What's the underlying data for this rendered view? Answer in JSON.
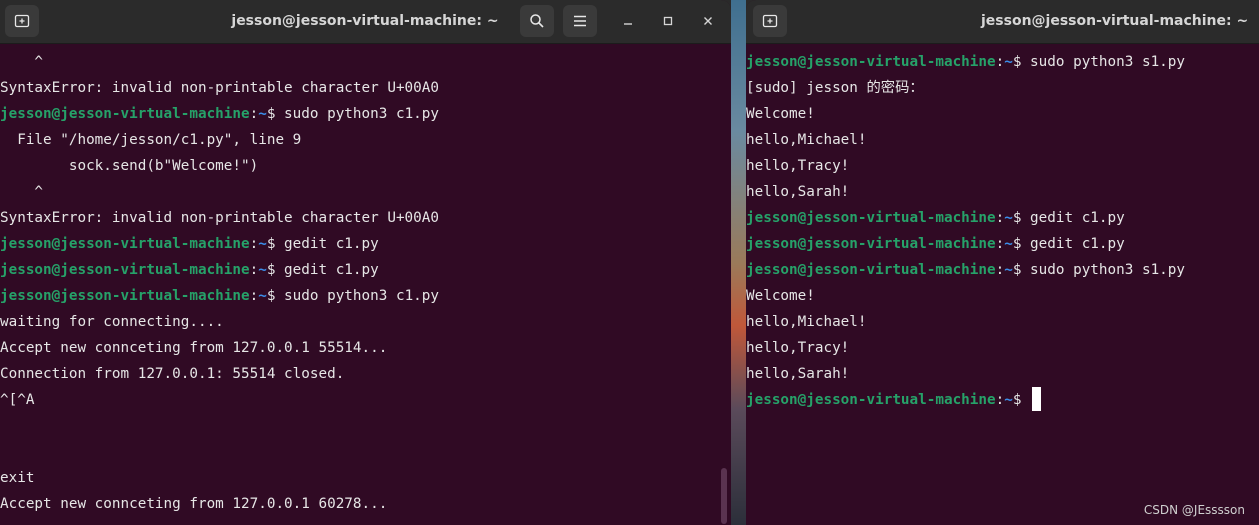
{
  "left_terminal": {
    "title": "jesson@jesson-virtual-machine: ~",
    "lines": [
      {
        "text": "    ^"
      },
      {
        "text": "SyntaxError: invalid non-printable character U+00A0"
      },
      {
        "prompt": true,
        "user": "jesson@jesson-virtual-machine",
        "path": "~",
        "cmd": "$ sudo python3 c1.py"
      },
      {
        "text": "  File \"/home/jesson/c1.py\", line 9"
      },
      {
        "text": "        sock.send(b\"Welcome!\")"
      },
      {
        "text": "    ^"
      },
      {
        "text": "SyntaxError: invalid non-printable character U+00A0"
      },
      {
        "prompt": true,
        "user": "jesson@jesson-virtual-machine",
        "path": "~",
        "cmd": "$ gedit c1.py"
      },
      {
        "prompt": true,
        "user": "jesson@jesson-virtual-machine",
        "path": "~",
        "cmd": "$ gedit c1.py"
      },
      {
        "prompt": true,
        "user": "jesson@jesson-virtual-machine",
        "path": "~",
        "cmd": "$ sudo python3 c1.py"
      },
      {
        "text": "waiting for connecting...."
      },
      {
        "text": "Accept new connceting from 127.0.0.1 55514..."
      },
      {
        "text": "Connection from 127.0.0.1: 55514 closed."
      },
      {
        "text": "^[^A"
      },
      {
        "text": ""
      },
      {
        "text": ""
      },
      {
        "text": "exit"
      },
      {
        "text": "Accept new connceting from 127.0.0.1 60278..."
      }
    ]
  },
  "right_terminal": {
    "title": "jesson@jesson-virtual-machine: ~",
    "lines": [
      {
        "prompt": true,
        "user": "jesson@jesson-virtual-machine",
        "path": "~",
        "cmd": "$ sudo python3 s1.py"
      },
      {
        "text": "[sudo] jesson 的密码："
      },
      {
        "text": "Welcome!"
      },
      {
        "text": "hello,Michael!"
      },
      {
        "text": "hello,Tracy!"
      },
      {
        "text": "hello,Sarah!"
      },
      {
        "prompt": true,
        "user": "jesson@jesson-virtual-machine",
        "path": "~",
        "cmd": "$ gedit c1.py"
      },
      {
        "prompt": true,
        "user": "jesson@jesson-virtual-machine",
        "path": "~",
        "cmd": "$ gedit c1.py"
      },
      {
        "prompt": true,
        "user": "jesson@jesson-virtual-machine",
        "path": "~",
        "cmd": "$ sudo python3 s1.py"
      },
      {
        "text": "Welcome!"
      },
      {
        "text": "hello,Michael!"
      },
      {
        "text": "hello,Tracy!"
      },
      {
        "text": "hello,Sarah!"
      },
      {
        "prompt": true,
        "user": "jesson@jesson-virtual-machine",
        "path": "~",
        "cmd": "$ ",
        "cursor": true
      }
    ]
  },
  "icons": {
    "new_tab": "new-tab-icon",
    "search": "search-icon",
    "menu": "hamburger-menu-icon",
    "minimize": "minimize-icon",
    "maximize": "maximize-icon",
    "close": "close-icon"
  },
  "colors": {
    "terminal_bg": "#300a24",
    "prompt_user": "#26a269",
    "prompt_path": "#3b8eea",
    "titlebar_bg": "#2b2b2b"
  },
  "watermark": "CSDN @JEsssson"
}
